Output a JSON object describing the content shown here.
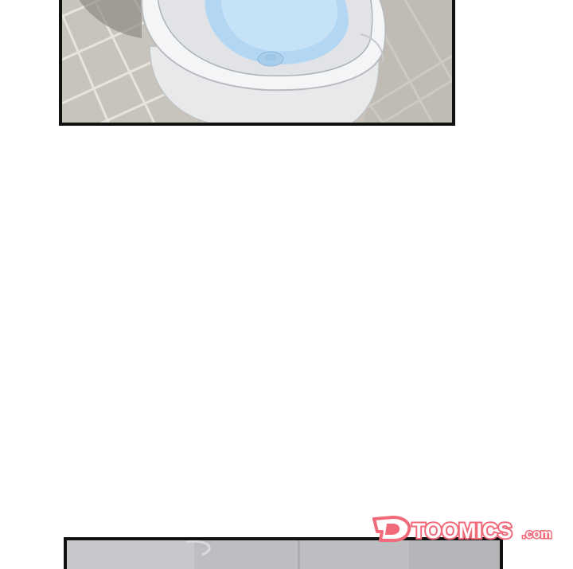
{
  "watermark": {
    "brand": "TOOMICS",
    "domain": ".com",
    "color": "#f06a7a"
  },
  "panels": [
    {
      "scene": "toilet-bowl-on-tiled-floor"
    },
    {
      "scene": "bathroom-wall-partial"
    }
  ]
}
